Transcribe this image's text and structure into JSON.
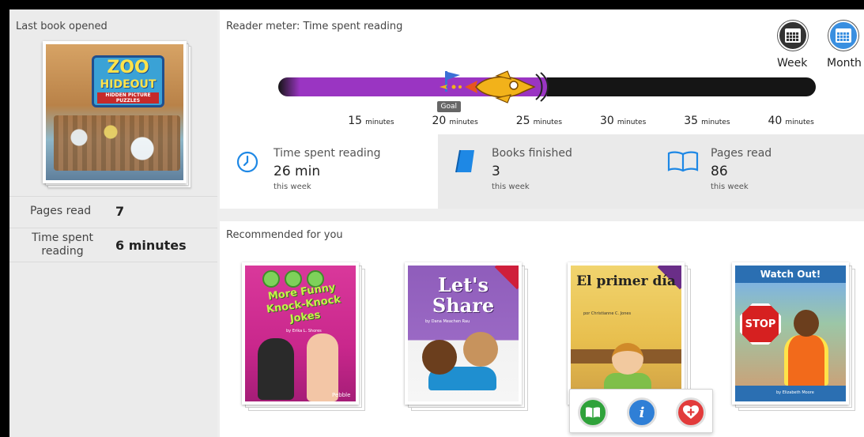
{
  "left_panel": {
    "title": "Last book opened",
    "last_book": {
      "title_line1": "ZOO",
      "title_line2": "HIDEOUT",
      "subtitle": "HIDDEN PICTURE PUZZLES"
    },
    "pages_read_label": "Pages read",
    "pages_read_value": "7",
    "time_spent_label": "Time spent reading",
    "time_spent_value": "6 minutes"
  },
  "reader_meter": {
    "title": "Reader meter: Time spent reading",
    "periods": [
      {
        "label": "Week",
        "active": true,
        "color": "#333333"
      },
      {
        "label": "Month",
        "active": false,
        "color": "#3a8fe0"
      }
    ],
    "goal_label": "Goal",
    "goal_minutes": 20,
    "progress_minutes": 26,
    "scale_min": 10,
    "scale_max": 42,
    "ticks": [
      {
        "value": "15",
        "unit": "minutes"
      },
      {
        "value": "20",
        "unit": "minutes"
      },
      {
        "value": "25",
        "unit": "minutes"
      },
      {
        "value": "30",
        "unit": "minutes"
      },
      {
        "value": "35",
        "unit": "minutes"
      },
      {
        "value": "40",
        "unit": "minutes"
      }
    ],
    "colors": {
      "fill": "#9a35c2",
      "track": "#151515",
      "rocket": "#f2b21a",
      "flag": "#3b6fd6"
    }
  },
  "stats": [
    {
      "label": "Time spent reading",
      "value": "26 min",
      "sub": "this week",
      "icon": "clock-icon"
    },
    {
      "label": "Books finished",
      "value": "3",
      "sub": "this week",
      "icon": "book-icon"
    },
    {
      "label": "Pages read",
      "value": "86",
      "sub": "this week",
      "icon": "open-book-icon"
    }
  ],
  "recommended": {
    "title": "Recommended for you",
    "books": [
      {
        "title": "More Funny Knock-Knock Jokes",
        "author": "by Erika L. Shores",
        "publisher": "Pebble"
      },
      {
        "title": "Let's Share",
        "author": "by Dana Meachen Rau"
      },
      {
        "title": "El primer día",
        "author": "por Christianne C. Jones"
      },
      {
        "title": "Watch Out!",
        "author": "by Elizabeth Moore"
      }
    ],
    "actions": [
      {
        "name": "read-book-button",
        "icon": "book-icon",
        "color": "#2fa23a"
      },
      {
        "name": "info-button",
        "icon": "info-icon",
        "color": "#2f7fd6"
      },
      {
        "name": "add-favorite-button",
        "icon": "heart-plus-icon",
        "color": "#e23b3b"
      }
    ]
  }
}
